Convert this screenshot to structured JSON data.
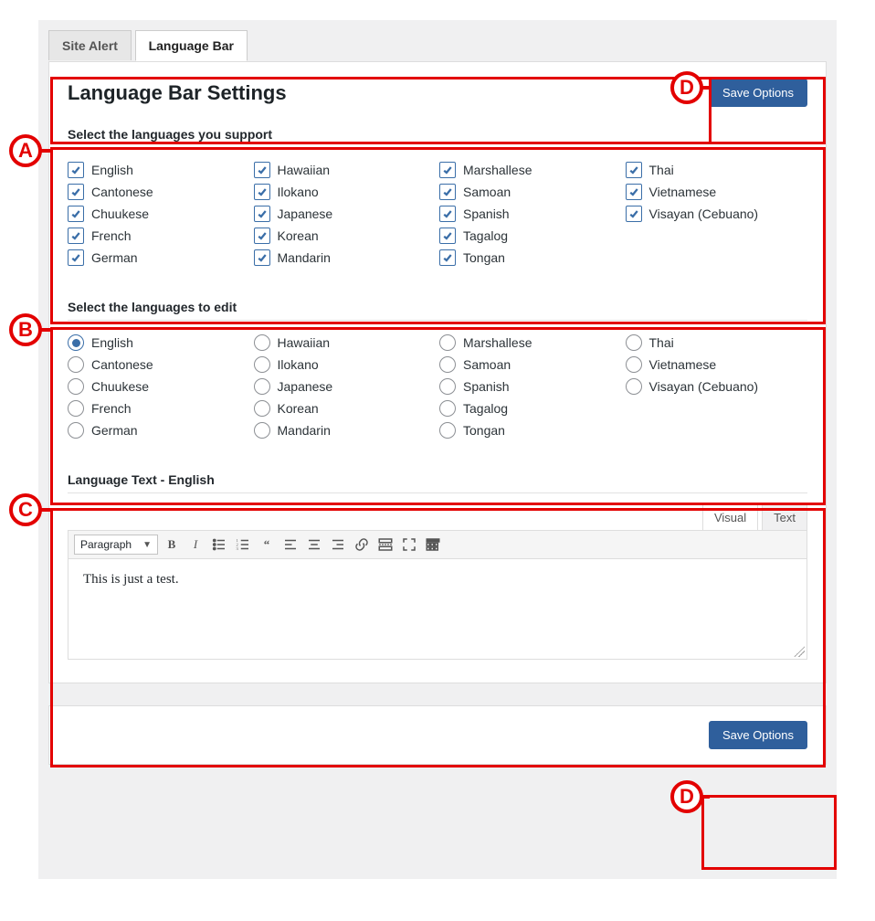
{
  "tabs": {
    "site_alert": "Site Alert",
    "language_bar": "Language Bar"
  },
  "headings": {
    "page_title": "Language Bar Settings",
    "section_support": "Select the languages you support",
    "section_edit": "Select the languages to edit",
    "section_text": "Language Text - English"
  },
  "buttons": {
    "save_top": "Save Options",
    "save_bottom": "Save Options"
  },
  "languages": {
    "col1": [
      "English",
      "Cantonese",
      "Chuukese",
      "French",
      "German"
    ],
    "col2": [
      "Hawaiian",
      "Ilokano",
      "Japanese",
      "Korean",
      "Mandarin"
    ],
    "col3": [
      "Marshallese",
      "Samoan",
      "Spanish",
      "Tagalog",
      "Tongan"
    ],
    "col4": [
      "Thai",
      "Vietnamese",
      "Visayan (Cebuano)"
    ]
  },
  "editor": {
    "visual_tab": "Visual",
    "text_tab": "Text",
    "format_select": "Paragraph",
    "content": "This is just a test."
  },
  "annotations": {
    "A": "A",
    "B": "B",
    "C": "C",
    "D": "D"
  }
}
